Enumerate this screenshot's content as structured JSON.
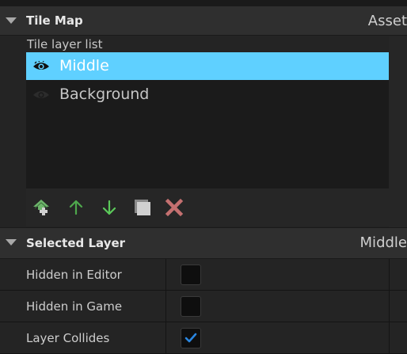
{
  "tile_map_section": {
    "title": "Tile Map",
    "right_text": "Asset",
    "list_label": "Tile layer list",
    "layers": [
      {
        "name": "Middle",
        "selected": true,
        "visible": true
      },
      {
        "name": "Background",
        "selected": false,
        "visible": false
      }
    ],
    "toolbar": [
      {
        "icon": "add-layer-icon",
        "color": "#6db56b"
      },
      {
        "icon": "arrow-up-icon",
        "color": "#4ea84c"
      },
      {
        "icon": "arrow-down-icon",
        "color": "#5bc95a"
      },
      {
        "icon": "duplicate-layer-icon",
        "color": "#d0d0d0"
      },
      {
        "icon": "delete-layer-icon",
        "color": "#c47070"
      }
    ]
  },
  "selected_layer_section": {
    "title": "Selected Layer",
    "right_text": "Middle",
    "properties": [
      {
        "label": "Hidden in Editor",
        "checked": false
      },
      {
        "label": "Hidden in Game",
        "checked": false
      },
      {
        "label": "Layer Collides",
        "checked": true
      }
    ]
  },
  "colors": {
    "selection": "#5fd0ff",
    "checkmark": "#2a86e0"
  }
}
